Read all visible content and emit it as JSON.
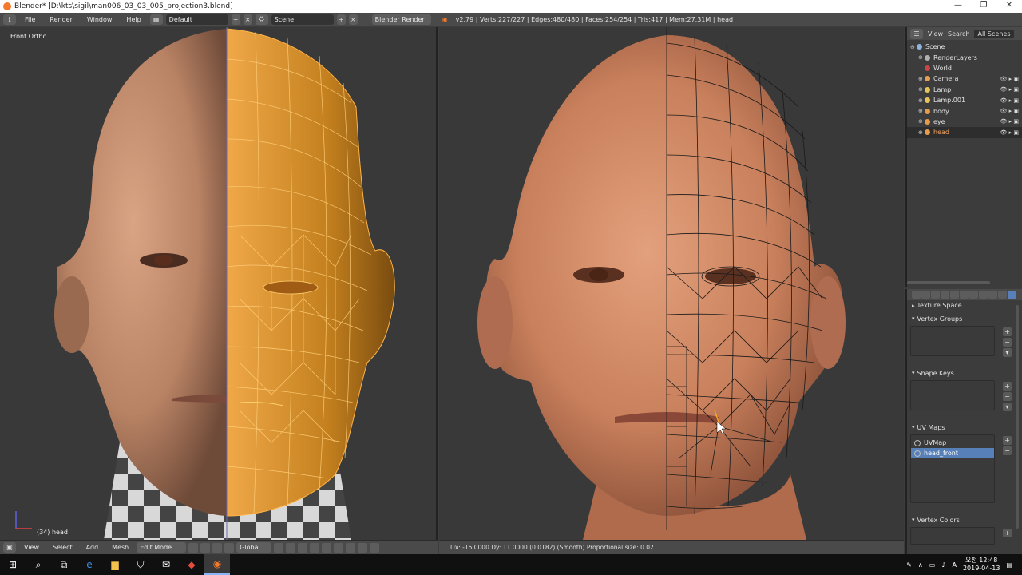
{
  "window": {
    "title": "Blender* [D:\\kts\\sigil\\man006_03_03_005_projection3.blend]",
    "controls": [
      "—",
      "❐",
      "✕"
    ]
  },
  "info_header": {
    "menus": [
      "File",
      "Render",
      "Window",
      "Help"
    ],
    "layout": "Default",
    "scene": "Scene",
    "engine": "Blender Render",
    "stats": "v2.79 | Verts:227/227 | Edges:480/480 | Faces:254/254 | Tris:417 | Mem:27.31M | head"
  },
  "left_viewport": {
    "view_label": "Front Ortho",
    "object_label": "(34) head",
    "footer_menus": [
      "View",
      "Select",
      "Add",
      "Mesh"
    ],
    "mode": "Edit Mode",
    "orientation": "Global"
  },
  "right_viewport": {
    "status": "Dx: -15.0000  Dy: 11.0000 (0.0182) (Smooth) Proportional size: 0.02"
  },
  "outliner": {
    "tabs": [
      "View",
      "Search",
      "All Scenes"
    ],
    "items": [
      {
        "name": "Scene",
        "color": "#8fb3de"
      },
      {
        "name": "RenderLayers",
        "color": "#b0b0b0"
      },
      {
        "name": "World",
        "color": "#c84848"
      },
      {
        "name": "Camera",
        "color": "#e6a054"
      },
      {
        "name": "Lamp",
        "color": "#e6c25a"
      },
      {
        "name": "Lamp.001",
        "color": "#e6c25a"
      },
      {
        "name": "body",
        "color": "#e69a4a"
      },
      {
        "name": "eye",
        "color": "#e69a4a"
      },
      {
        "name": "head",
        "color": "#e69a4a"
      }
    ]
  },
  "properties": {
    "panels": {
      "texture_space": "Texture Space",
      "vertex_groups": "Vertex Groups",
      "shape_keys": "Shape Keys",
      "uv_maps": "UV Maps",
      "vertex_colors": "Vertex Colors"
    },
    "uv_maps": [
      "UVMap",
      "head_front"
    ]
  },
  "taskbar": {
    "time": "오전 12:48",
    "date": "2019-04-13"
  },
  "colors": {
    "accent": "#5880b8",
    "mesh_selected": "#f5a623",
    "skin": "#c98c66"
  }
}
